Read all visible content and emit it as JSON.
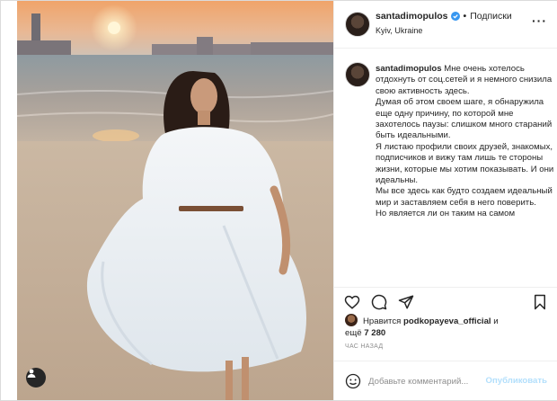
{
  "post": {
    "username": "santadimopulos",
    "follow_label": "Подписки",
    "location": "Kyiv, Ukraine",
    "more_label": "···",
    "caption": {
      "username": "santadimopulos",
      "paragraphs": [
        "Мне очень хотелось отдохнуть от соц.сетей и я немного снизила свою активность здесь.",
        "Думая об этом своем шаге, я обнаружила еще одну причину, по которой мне захотелось паузы: слишком много стараний быть идеальными.",
        "Я листаю профили своих друзей, знакомых, подписчиков и вижу там лишь те стороны жизни, которые мы хотим показывать. И они идеальны.",
        "Мы все здесь как будто создаем идеальный мир и заставляем себя в него поверить.",
        "Но является ли он таким на самом"
      ]
    },
    "likes": {
      "prefix": "Нравится",
      "user": "podkopayeva_official",
      "suffix": "и",
      "more_prefix": "ещё",
      "count": "7 280"
    },
    "timestamp": "ЧАС НАЗАД",
    "comment": {
      "placeholder": "Добавьте комментарий...",
      "publish_label": "Опубликовать"
    },
    "icons": {
      "like": "heart-icon",
      "comment": "comment-icon",
      "share": "paper-plane-icon",
      "save": "bookmark-icon",
      "emoji": "smiley-icon",
      "tagged": "user-tag-icon",
      "verified": "verified-badge-icon"
    },
    "colors": {
      "verified": "#3897f0",
      "publish_disabled": "#b2dffc",
      "muted": "#8e8e8e"
    }
  }
}
